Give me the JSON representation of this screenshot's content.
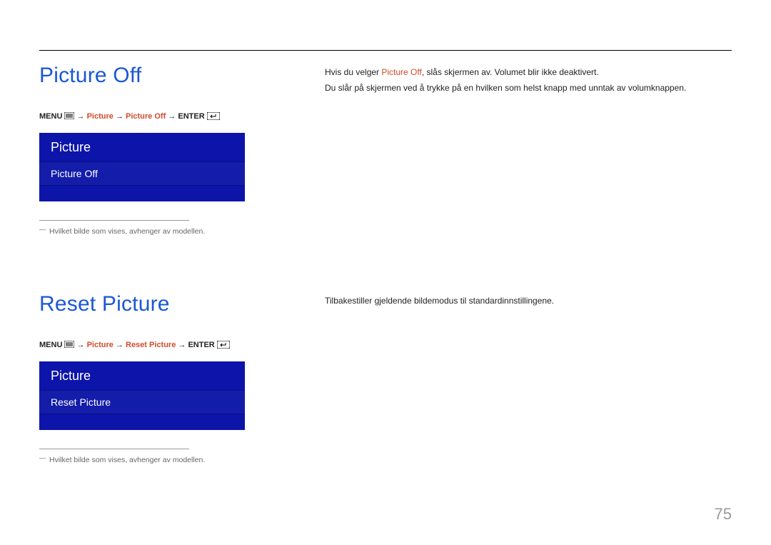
{
  "page_number": "75",
  "section1": {
    "title": "Picture Off",
    "nav": {
      "menu": "MENU",
      "p1": "Picture",
      "p2": "Picture Off",
      "enter": "ENTER"
    },
    "menu_header": "Picture",
    "menu_item": "Picture Off",
    "footnote": "Hvilket bilde som vises, avhenger av modellen.",
    "body_pre": "Hvis du velger ",
    "body_red": "Picture Off",
    "body_post": ", slås skjermen av. Volumet blir ikke deaktivert.",
    "body_line2": "Du slår på skjermen ved å trykke på en hvilken som helst knapp med unntak av volumknappen."
  },
  "section2": {
    "title": "Reset Picture",
    "nav": {
      "menu": "MENU",
      "p1": "Picture",
      "p2": "Reset Picture",
      "enter": "ENTER"
    },
    "menu_header": "Picture",
    "menu_item": "Reset Picture",
    "footnote": "Hvilket bilde som vises, avhenger av modellen.",
    "body": "Tilbakestiller gjeldende bildemodus til standardinnstillingene."
  }
}
